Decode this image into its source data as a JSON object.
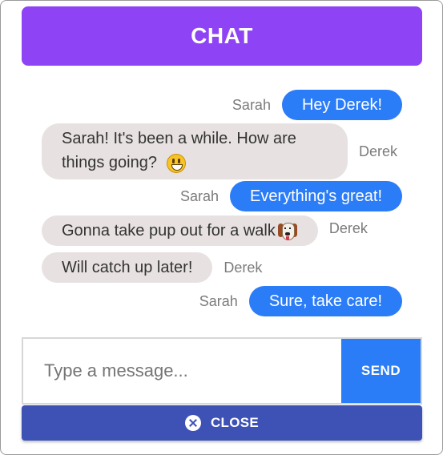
{
  "header": {
    "title": "CHAT"
  },
  "messages": [
    {
      "sender": "Sarah",
      "text": "Hey Derek!",
      "direction": "sent"
    },
    {
      "sender": "Derek",
      "text": "Sarah! It's been a while. How are things going?",
      "direction": "received",
      "emoji": "smiley-icon"
    },
    {
      "sender": "Sarah",
      "text": "Everything's great!",
      "direction": "sent"
    },
    {
      "sender": "Derek",
      "text": "Gonna take pup out for a walk",
      "direction": "received",
      "emoji": "dog-icon"
    },
    {
      "sender": "Derek",
      "text": "Will catch up later!",
      "direction": "received"
    },
    {
      "sender": "Sarah",
      "text": "Sure, take care!",
      "direction": "sent"
    }
  ],
  "composer": {
    "placeholder": "Type a message...",
    "value": "",
    "send_label": "SEND"
  },
  "close": {
    "label": "CLOSE",
    "icon": "close-circle-icon"
  },
  "colors": {
    "header": "#8e44f5",
    "sent_bubble": "#2b7cf7",
    "received_bubble": "#e7e2e1",
    "send_button": "#2b7cf7",
    "close_button": "#3e51b5"
  }
}
